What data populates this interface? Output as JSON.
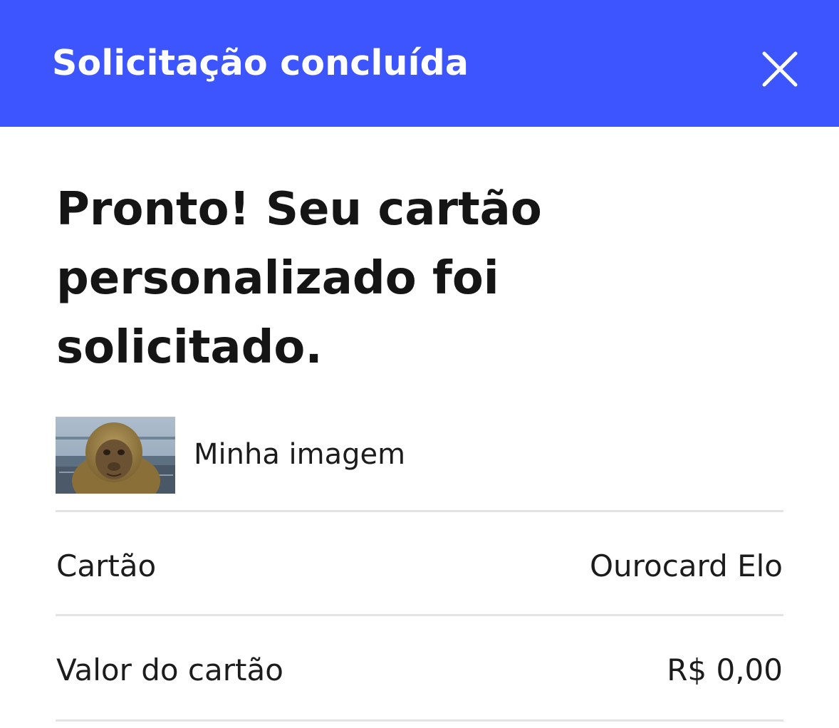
{
  "header": {
    "title": "Solicitação concluída",
    "close_icon": "close-icon",
    "color": "#3d55ff"
  },
  "headline": {
    "lines": [
      "Pronto! Seu cartão",
      "personalizado foi",
      "solicitado."
    ]
  },
  "image": {
    "label": "Minha imagem"
  },
  "details": [
    {
      "label": "Cartão",
      "value": "Ourocard Elo"
    },
    {
      "label": "Valor do cartão",
      "value": "R$ 0,00"
    }
  ]
}
